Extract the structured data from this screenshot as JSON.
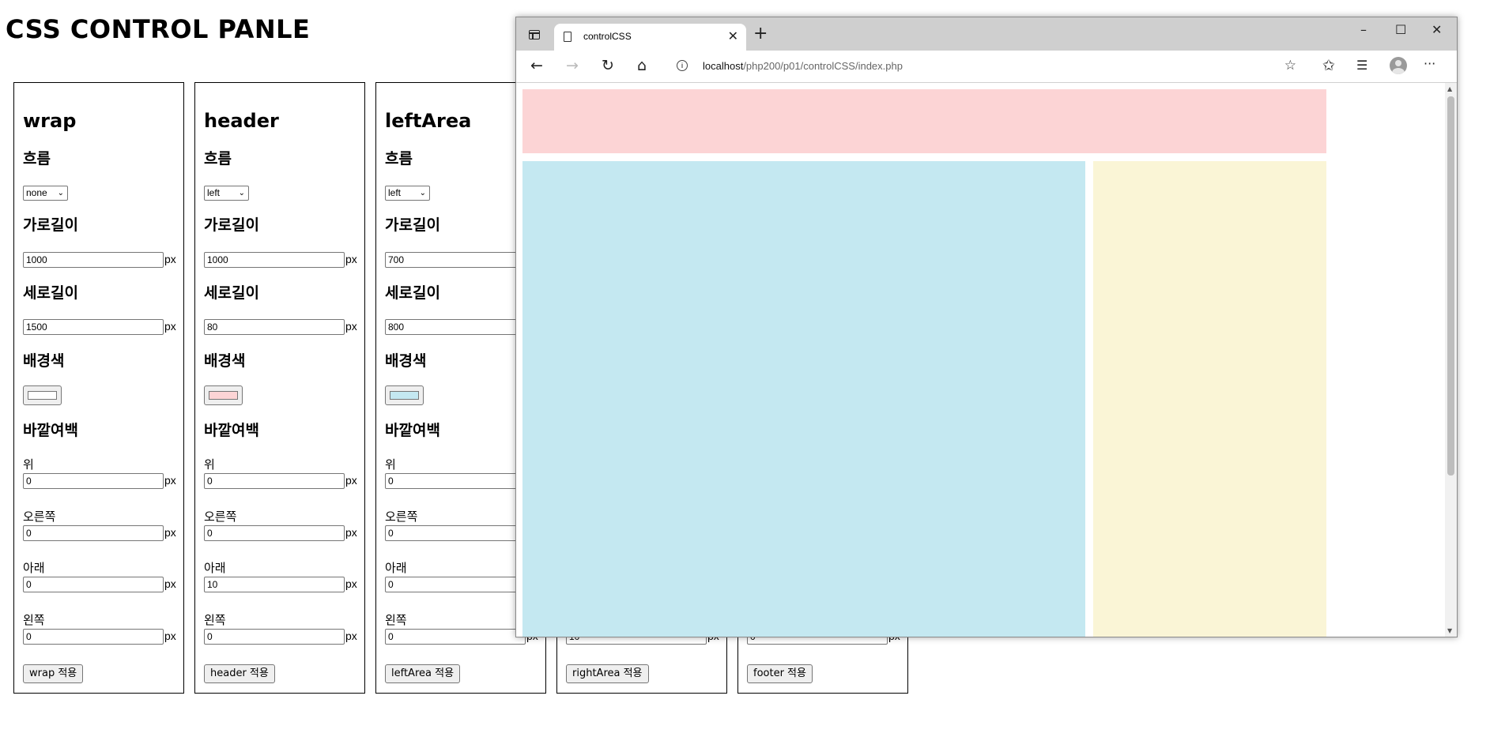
{
  "page": {
    "title": "CSS CONTROL PANLE"
  },
  "colors": {
    "wrap_bg": "#ffffff",
    "header_bg": "#fcd4d5",
    "leftArea_bg": "#c4e8f1",
    "rightArea_bg": "#faf5d6",
    "accent_border": "#767676"
  },
  "labels": {
    "flow": "흐름",
    "width": "가로길이",
    "height": "세로길이",
    "bgcolor": "배경색",
    "margin": "바깥여백",
    "top": "위",
    "right": "오른쪽",
    "bottom": "아래",
    "left": "왼쪽",
    "unit": "px"
  },
  "panels": [
    {
      "title": "wrap",
      "float": "none",
      "width": "1000",
      "height": "1500",
      "bg_color": "#ffffff",
      "margin": {
        "top": "0",
        "right": "0",
        "bottom": "0",
        "left": "0"
      },
      "apply_label": "wrap 적용"
    },
    {
      "title": "header",
      "float": "left",
      "width": "1000",
      "height": "80",
      "bg_color": "#fcd4d5",
      "margin": {
        "top": "0",
        "right": "0",
        "bottom": "10",
        "left": "0"
      },
      "apply_label": "header 적용"
    },
    {
      "title": "leftArea",
      "float": "left",
      "width": "700",
      "height": "800",
      "bg_color": "#c4e8f1",
      "margin": {
        "top": "0",
        "right": "0",
        "bottom": "0",
        "left": "0"
      },
      "apply_label": "leftArea 적용"
    },
    {
      "title": "rightArea",
      "margin": {
        "left": "10"
      },
      "apply_label": "rightArea 적용"
    },
    {
      "title": "footer",
      "margin": {
        "left": "0"
      },
      "apply_label": "footer 적용"
    }
  ],
  "browser": {
    "tab_title": "controlCSS",
    "url_host": "localhost",
    "url_path": "/php200/p01/controlCSS/index.php",
    "icons": {
      "back": "←",
      "forward": "→",
      "reload": "↻",
      "home": "⌂",
      "close_tab": "✕",
      "new_tab": "+",
      "minimize": "–",
      "maximize": "☐",
      "close": "✕",
      "favorites": "✩",
      "collections": "☰",
      "more": "···",
      "add_favorite": "☆",
      "info": "i"
    }
  }
}
